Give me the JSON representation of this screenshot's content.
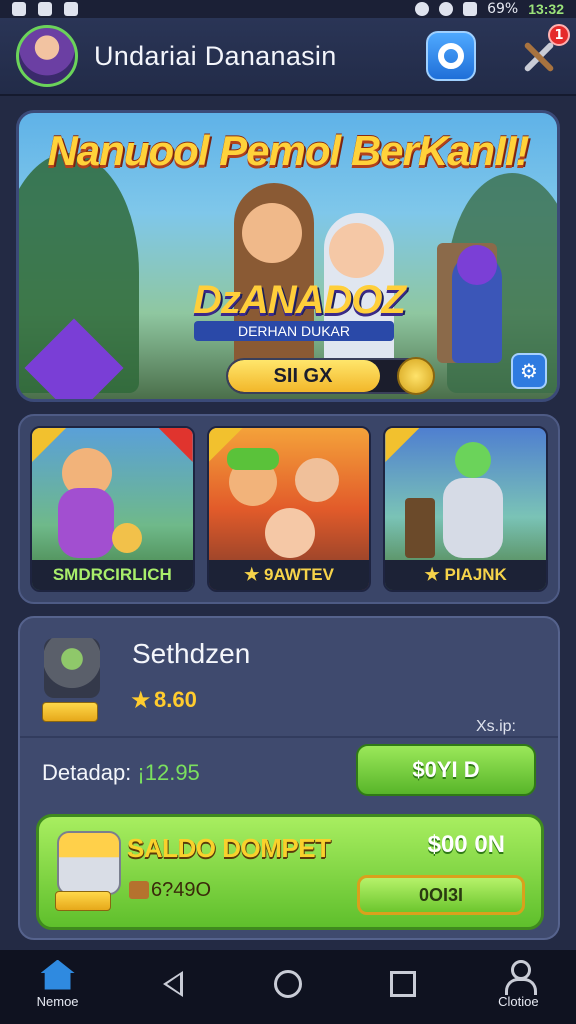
{
  "status_bar": {
    "battery": "69%",
    "time": "13:32"
  },
  "header": {
    "title": "Undariai Dananasin",
    "notification_count": "1"
  },
  "hero": {
    "headline": "Nanuool Pemol BerKanII!",
    "logo": "DzANADOZ",
    "logo_sub": "DERHAN DUKAR",
    "progress_label": "SII GX",
    "progress_fraction": 0.75
  },
  "games": [
    {
      "label": "SMDRCIRLICH"
    },
    {
      "label": "★ 9AWTEV"
    },
    {
      "label": "★ PIAJNK"
    }
  ],
  "player": {
    "name": "Sethdzen",
    "rating": "8.60",
    "meta": "Xs.ip:"
  },
  "detail": {
    "label": "Detadap: ",
    "value": "¡12.95",
    "button": "$0YI D"
  },
  "saldo": {
    "title": "SALDO DOMPET",
    "amount": "$00 0N",
    "sub": "6?49O",
    "button": "0OI3I"
  },
  "navbar": {
    "home_label": "Nemoe",
    "profile_label": "Clotioe"
  },
  "colors": {
    "accent_green": "#7be05e",
    "accent_gold": "#ffcc2e",
    "background": "#232a44"
  }
}
